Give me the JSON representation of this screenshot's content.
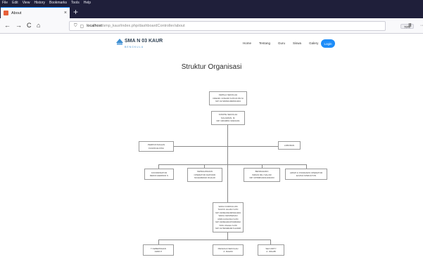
{
  "menubar": {
    "items": [
      "File",
      "Edit",
      "View",
      "History",
      "Bookmarks",
      "Tools",
      "Help"
    ]
  },
  "tab": {
    "title": "About",
    "close": "×",
    "new_tab": "+"
  },
  "navbar": {
    "back": "←",
    "forward": "→",
    "reload": "C",
    "home": "⌂",
    "url_host": "localhost",
    "url_path": "/smp_kaur/index.php/dashboardController/about",
    "zoom": "70%",
    "page_actions": "···",
    "pocket": "☐",
    "bookmark": "☆",
    "library": "Ⅲ"
  },
  "site": {
    "logo_title": "SMA N 03 KAUR",
    "logo_sub": "BENGKULU",
    "nav": [
      "Home",
      "Tentang",
      "Guru",
      "Siswa",
      "Galery"
    ],
    "login": "Login"
  },
  "page_title": "Struktur Organisasi",
  "org": {
    "kepala": [
      "KEPALA SEKOLAH",
      "FRENKI JUNAIDI S.PD.M.PD.SI",
      "NIP 197208041998031004"
    ],
    "komite": [
      "KOMITE SEKOLAH",
      "SULAIMAN, M.",
      "NIP 19640801 90321001"
    ],
    "perpustakaan": [
      "PERPUSTAKAAN",
      "FAUZIA ELFINA"
    ],
    "laboran": [
      "LABORAN"
    ],
    "koordinator": [
      "KOORDINATOR",
      "RENNI HERMAN S"
    ],
    "kepegawaian": [
      "KEPEGAWAIAN",
      "OPERATOR DAPODIK",
      "MUHAMMAD DUALDI"
    ],
    "bendahara": [
      "BENDAHARA",
      "IMRAN MILI SALOR",
      "NIP 197808102011011003"
    ],
    "arsip": [
      "ARSIP & STANDARD OPERATOR",
      "ELVIDA SINDULTON"
    ],
    "wakasek": [
      "WAKA KURIKULUM",
      "TAUFIK HAJAN S.PD",
      "NIP 196602032005021003",
      "WAKA KESISWAAN",
      "MIPA KASUNGI S.PD",
      "NIP 196602202070066002",
      "TATA USAHA S.PD",
      "NIP 197609082007122008"
    ],
    "tu": [
      "T KEBERSIHAN",
      "AMIR P."
    ],
    "penjaga": [
      "PENJAGA SEKOLAH",
      "A. RAHIM"
    ],
    "security": [
      "SECURITY",
      "A. WAHIB"
    ]
  }
}
